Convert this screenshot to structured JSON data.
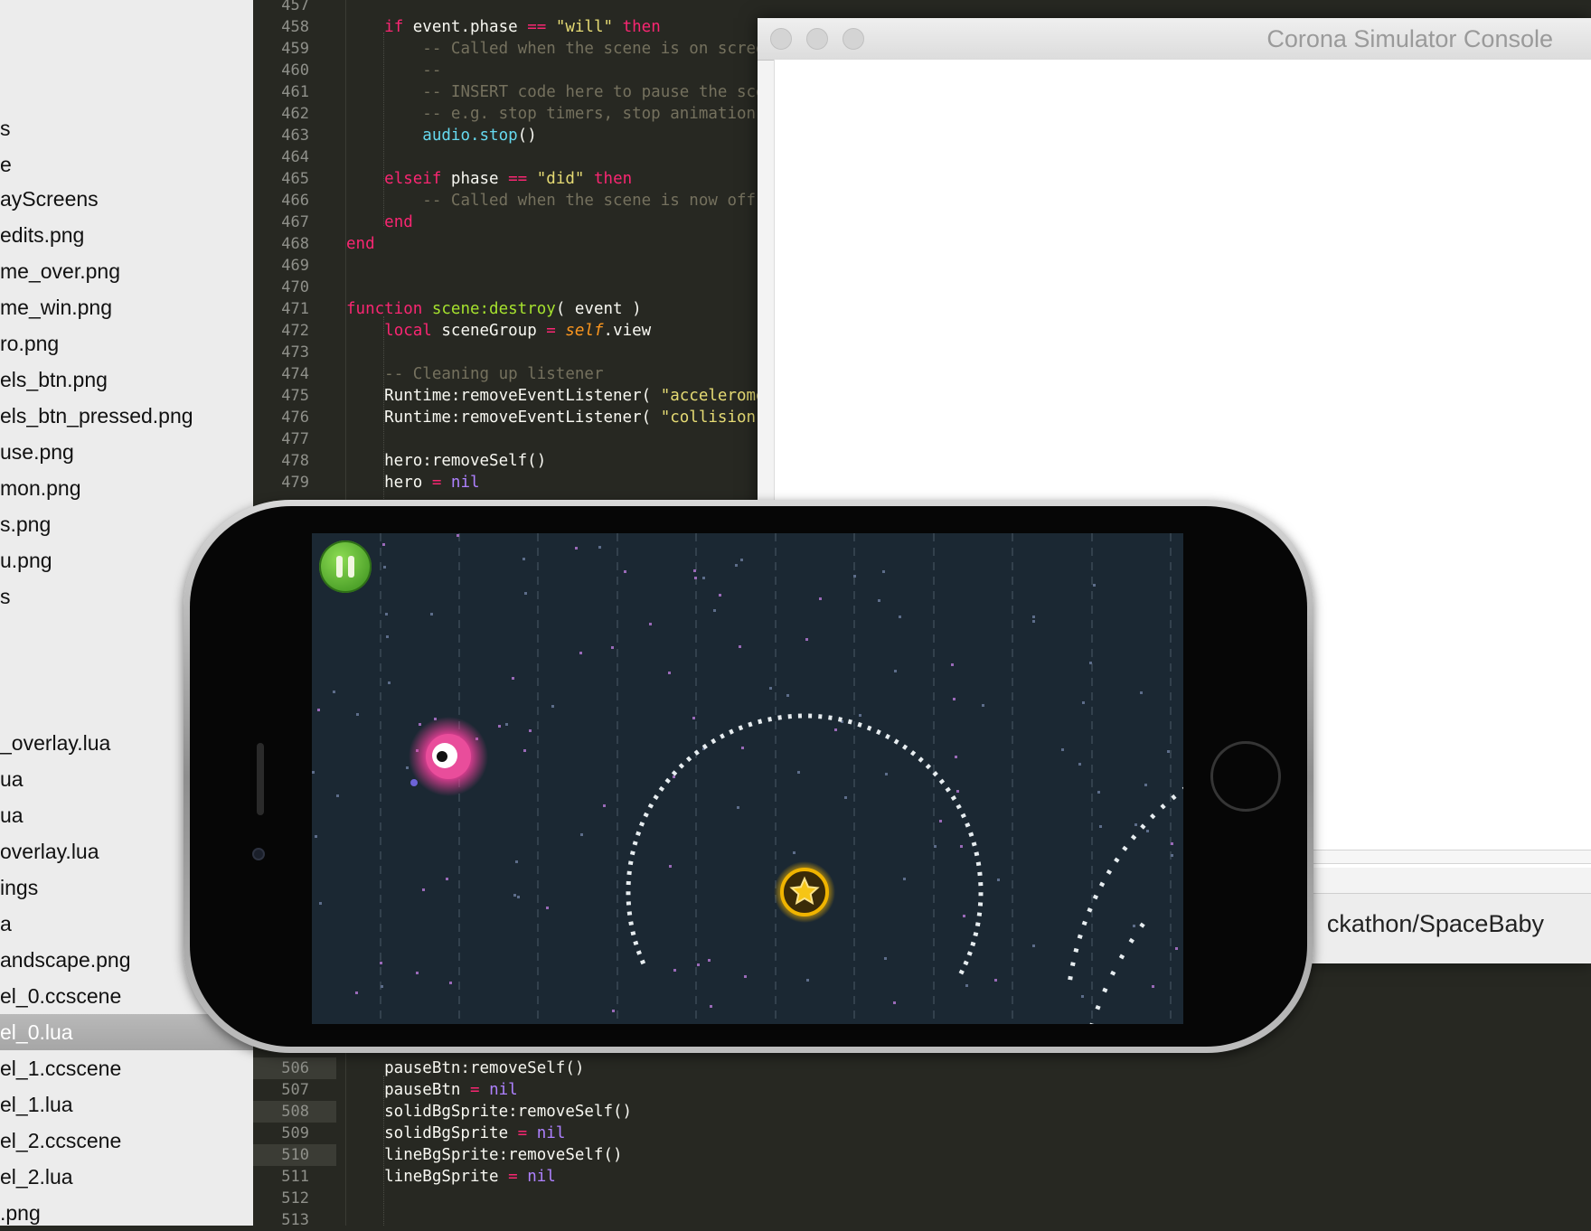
{
  "sidebar": {
    "items": [
      {
        "label": "s"
      },
      {
        "label": "e"
      },
      {
        "label": "ayScreens"
      },
      {
        "label": "edits.png"
      },
      {
        "label": "me_over.png"
      },
      {
        "label": "me_win.png"
      },
      {
        "label": "ro.png"
      },
      {
        "label": "els_btn.png"
      },
      {
        "label": "els_btn_pressed.png"
      },
      {
        "label": "use.png"
      },
      {
        "label": "mon.png"
      },
      {
        "label": "s.png"
      },
      {
        "label": "u.png"
      },
      {
        "label": "s"
      },
      {
        "label": "_overlay.lua"
      },
      {
        "label": "ua"
      },
      {
        "label": "ua"
      },
      {
        "label": "overlay.lua"
      },
      {
        "label": "ings"
      },
      {
        "label": "a"
      },
      {
        "label": "andscape.png"
      },
      {
        "label": "el_0.ccscene"
      },
      {
        "label": "el_0.lua"
      },
      {
        "label": "el_1.ccscene"
      },
      {
        "label": "el_1.lua"
      },
      {
        "label": "el_2.ccscene"
      },
      {
        "label": "el_2.lua"
      },
      {
        "label": ".png"
      }
    ],
    "selected_index": 22
  },
  "editor": {
    "top_lines": [
      {
        "n": "457",
        "tokens": []
      },
      {
        "n": "458",
        "tokens": [
          [
            "",
            "    "
          ],
          [
            "kw",
            "if"
          ],
          [
            "",
            " event.phase "
          ],
          [
            "kw",
            "=="
          ],
          [
            "",
            " "
          ],
          [
            "str",
            "\"will\""
          ],
          [
            "",
            " "
          ],
          [
            "kw",
            "then"
          ]
        ]
      },
      {
        "n": "459",
        "tokens": [
          [
            "",
            "        "
          ],
          [
            "cmt",
            "-- Called when the scene is on screen"
          ]
        ]
      },
      {
        "n": "460",
        "tokens": [
          [
            "",
            "        "
          ],
          [
            "cmt",
            "--"
          ]
        ]
      },
      {
        "n": "461",
        "tokens": [
          [
            "",
            "        "
          ],
          [
            "cmt",
            "-- INSERT code here to pause the scene"
          ]
        ]
      },
      {
        "n": "462",
        "tokens": [
          [
            "",
            "        "
          ],
          [
            "cmt",
            "-- e.g. stop timers, stop animation, u"
          ]
        ]
      },
      {
        "n": "463",
        "tokens": [
          [
            "",
            "        "
          ],
          [
            "bi",
            "audio.stop"
          ],
          [
            "",
            "()"
          ]
        ]
      },
      {
        "n": "464",
        "tokens": []
      },
      {
        "n": "465",
        "tokens": [
          [
            "",
            "    "
          ],
          [
            "kw",
            "elseif"
          ],
          [
            "",
            " phase "
          ],
          [
            "kw",
            "=="
          ],
          [
            "",
            " "
          ],
          [
            "str",
            "\"did\""
          ],
          [
            "",
            " "
          ],
          [
            "kw",
            "then"
          ]
        ]
      },
      {
        "n": "466",
        "tokens": [
          [
            "",
            "        "
          ],
          [
            "cmt",
            "-- Called when the scene is now off sc"
          ]
        ]
      },
      {
        "n": "467",
        "tokens": [
          [
            "",
            "    "
          ],
          [
            "kw",
            "end"
          ]
        ]
      },
      {
        "n": "468",
        "tokens": [
          [
            "kw",
            "end"
          ]
        ]
      },
      {
        "n": "469",
        "tokens": []
      },
      {
        "n": "470",
        "tokens": []
      },
      {
        "n": "471",
        "tokens": [
          [
            "kw",
            "function"
          ],
          [
            "",
            " "
          ],
          [
            "fn",
            "scene:destroy"
          ],
          [
            "",
            "( event )"
          ]
        ]
      },
      {
        "n": "472",
        "tokens": [
          [
            "",
            "    "
          ],
          [
            "kw",
            "local"
          ],
          [
            "",
            " sceneGroup "
          ],
          [
            "kw",
            "="
          ],
          [
            "",
            " "
          ],
          [
            "self",
            "self"
          ],
          [
            "",
            ".view"
          ]
        ]
      },
      {
        "n": "473",
        "tokens": []
      },
      {
        "n": "474",
        "tokens": [
          [
            "",
            "    "
          ],
          [
            "cmt",
            "-- Cleaning up listener"
          ]
        ]
      },
      {
        "n": "475",
        "tokens": [
          [
            "",
            "    Runtime:removeEventListener( "
          ],
          [
            "str",
            "\"acceleromete"
          ]
        ]
      },
      {
        "n": "476",
        "tokens": [
          [
            "",
            "    Runtime:removeEventListener( "
          ],
          [
            "str",
            "\"collision\""
          ],
          [
            "",
            ","
          ]
        ]
      },
      {
        "n": "477",
        "tokens": []
      },
      {
        "n": "478",
        "tokens": [
          [
            "",
            "    hero:removeSelf()"
          ]
        ]
      },
      {
        "n": "479",
        "tokens": [
          [
            "",
            "    hero "
          ],
          [
            "kw",
            "="
          ],
          [
            "",
            " "
          ],
          [
            "nil",
            "nil"
          ]
        ]
      }
    ],
    "bottom_lines": [
      {
        "n": "506",
        "hl": true,
        "tokens": [
          [
            "",
            "    pauseBtn:removeSelf()"
          ]
        ]
      },
      {
        "n": "507",
        "hl": false,
        "tokens": [
          [
            "",
            "    pauseBtn "
          ],
          [
            "kw",
            "="
          ],
          [
            "",
            " "
          ],
          [
            "nil",
            "nil"
          ]
        ]
      },
      {
        "n": "508",
        "hl": true,
        "tokens": [
          [
            "",
            "    solidBgSprite:removeSelf()"
          ]
        ]
      },
      {
        "n": "509",
        "hl": false,
        "tokens": [
          [
            "",
            "    solidBgSprite "
          ],
          [
            "kw",
            "="
          ],
          [
            "",
            " "
          ],
          [
            "nil",
            "nil"
          ]
        ]
      },
      {
        "n": "510",
        "hl": true,
        "tokens": [
          [
            "",
            "    lineBgSprite:removeSelf()"
          ]
        ]
      },
      {
        "n": "511",
        "hl": false,
        "tokens": [
          [
            "",
            "    lineBgSprite "
          ],
          [
            "kw",
            "="
          ],
          [
            "",
            " "
          ],
          [
            "nil",
            "nil"
          ]
        ]
      },
      {
        "n": "512",
        "hl": false,
        "tokens": []
      },
      {
        "n": "513",
        "hl": false,
        "tokens": []
      }
    ]
  },
  "console": {
    "title": "Corona Simulator Console",
    "path": "ckathon/SpaceBaby"
  },
  "game": {
    "pause_icon": "pause-icon",
    "hero_icon": "space-baby-eye-icon",
    "star_icon": "star-coin-icon"
  }
}
